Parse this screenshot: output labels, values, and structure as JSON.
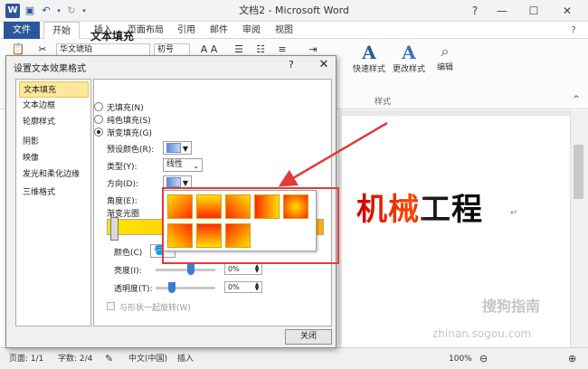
{
  "titlebar": {
    "title": "文档2 - Microsoft Word",
    "word_icon": "W",
    "controls": [
      "?",
      "—",
      "☐",
      "✕"
    ]
  },
  "tabs": [
    "文件",
    "开始",
    "插入",
    "页面布局",
    "引用",
    "邮件",
    "审阅",
    "视图"
  ],
  "ribbon": {
    "font_name": "华文琥珀",
    "font_size": "初号",
    "quick_styles": "快速样式",
    "change_styles": "更改样式",
    "styles_group": "样式",
    "edit": "编辑"
  },
  "dialog": {
    "title": "设置文本效果格式",
    "help": "?",
    "close_x": "✕",
    "categories": [
      "文本填充",
      "文本边框",
      "轮廓样式",
      "阴影",
      "映像",
      "发光和柔化边缘",
      "三维格式"
    ],
    "selected_category": "文本填充",
    "pane_title": "文本填充",
    "fill_options": [
      "无填充(N)",
      "纯色填充(S)",
      "渐变填充(G)"
    ],
    "selected_fill": "渐变填充(G)",
    "preset_label": "预设颜色(R):",
    "type_label": "类型(Y):",
    "type_value": "线性",
    "direction_label": "方向(D):",
    "angle_label": "角度(E):",
    "stops_label": "渐变光圈",
    "color_label": "颜色(C)",
    "brightness_label": "亮度(I):",
    "brightness_value": "0%",
    "transparency_label": "透明度(T):",
    "transparency_value": "0%",
    "rotate_label": "与形状一起旋转(W)",
    "close_button": "关闭"
  },
  "document": {
    "text": "机械工程"
  },
  "statusbar": {
    "page": "页面: 1/1",
    "words": "字数: 2/4",
    "lang": "中文(中国)",
    "mode": "插入",
    "zoom": "100%"
  },
  "watermark": {
    "text": "搜狗指南",
    "url": "zhinan.sogou.com"
  },
  "colors": {
    "accent": "#2b579a",
    "highlight": "#e23a3a",
    "gradient_start": "#ff2a00",
    "gradient_end": "#ffe000"
  }
}
